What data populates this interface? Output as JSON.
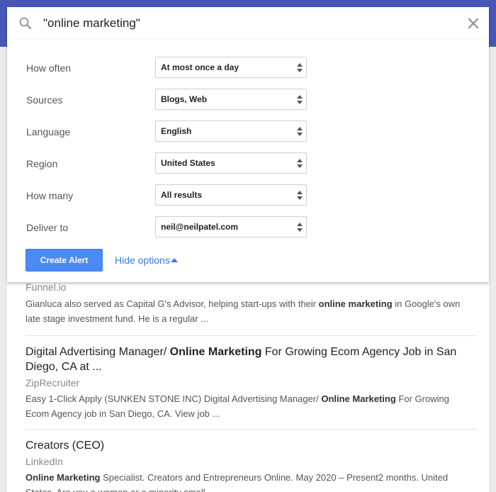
{
  "search": {
    "query": "\"online marketing\""
  },
  "options": [
    {
      "label": "How often",
      "value": "At most once a day"
    },
    {
      "label": "Sources",
      "value": "Blogs, Web"
    },
    {
      "label": "Language",
      "value": "English"
    },
    {
      "label": "Region",
      "value": "United States"
    },
    {
      "label": "How many",
      "value": "All results"
    },
    {
      "label": "Deliver to",
      "value": "neil@neilpatel.com"
    }
  ],
  "actions": {
    "create_label": "Create Alert",
    "hide_label": "Hide options"
  },
  "results": [
    {
      "source": "Funnel.io",
      "snippet_parts": [
        {
          "text": "Gianluca also served as Capital G's Advisor, helping start-ups with their ",
          "bold": false
        },
        {
          "text": "online marketing",
          "bold": true
        },
        {
          "text": " in Google's own late stage investment fund. He is a regular ...",
          "bold": false
        }
      ]
    },
    {
      "title_parts": [
        {
          "text": "Digital Advertising Manager/ ",
          "bold": false
        },
        {
          "text": "Online Marketing",
          "bold": true
        },
        {
          "text": " For Growing Ecom Agency Job in San Diego, CA at ...",
          "bold": false
        }
      ],
      "source": "ZipRecruiter",
      "snippet_parts": [
        {
          "text": "Easy 1-Click Apply (SUNKEN STONE INC) Digital Advertising Manager/ ",
          "bold": false
        },
        {
          "text": "Online Marketing",
          "bold": true
        },
        {
          "text": " For Growing Ecom Agency job in San Diego, CA. View job ...",
          "bold": false
        }
      ]
    },
    {
      "title_parts": [
        {
          "text": "Creators (CEO)",
          "bold": false
        }
      ],
      "source": "LinkedIn",
      "snippet_parts": [
        {
          "text": "Online Marketing",
          "bold": true
        },
        {
          "text": " Specialist. Creators and Entrepreneurs Online. May 2020 – Present2 months. United States. Are you a woman or a minority small ...",
          "bold": false
        }
      ]
    }
  ],
  "colors": {
    "header_band": "#4756b8",
    "primary_button": "#4a8af4",
    "link": "#3b78e7"
  },
  "icons": {
    "search": "search-icon",
    "close": "close-icon",
    "select_arrows": "up-down-arrows-icon",
    "caret": "caret-up-icon"
  }
}
